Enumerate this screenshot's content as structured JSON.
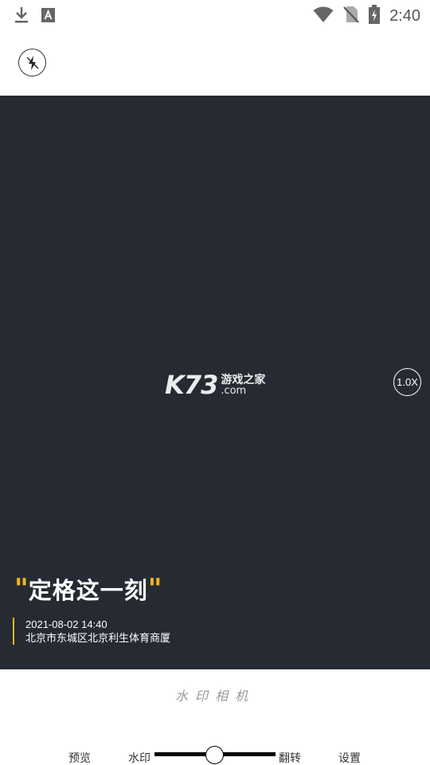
{
  "status_bar": {
    "time": "2:40",
    "icons": [
      "download-icon",
      "text-a-icon",
      "wifi-icon",
      "no-sim-icon",
      "battery-charging-icon"
    ]
  },
  "toolbar": {
    "flash_icon": "flash-off-icon"
  },
  "viewfinder": {
    "logo": {
      "main": "K73",
      "cn": "游戏之家",
      "domain": ".com"
    },
    "zoom_label": "1.0X",
    "watermark": {
      "quote_open": "\"",
      "slogan": "定格这一刻",
      "quote_close": "\"",
      "datetime": "2021-08-02  14:40",
      "address": "北京市东城区北京利生体育商厦"
    }
  },
  "bottom": {
    "app_title": "水印相机",
    "nav": {
      "preview": "预览",
      "watermark": "水印",
      "flip": "翻转",
      "settings": "设置"
    }
  },
  "colors": {
    "viewfinder_bg": "#262b33",
    "accent": "#f5b51d"
  }
}
